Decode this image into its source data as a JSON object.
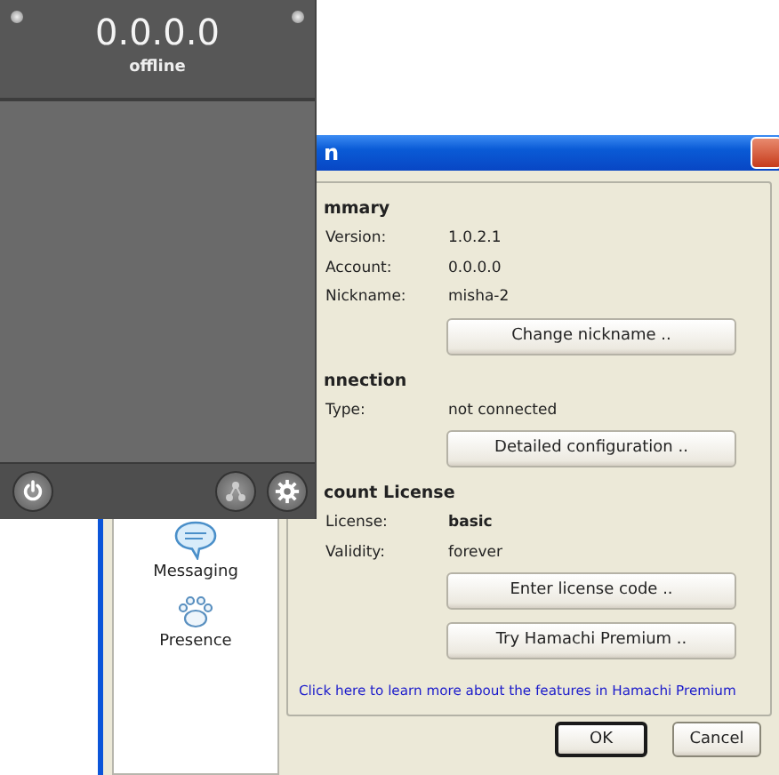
{
  "client": {
    "address": "0.0.0.0",
    "status": "offline"
  },
  "dialog": {
    "title": "n",
    "sidebar": {
      "items": [
        {
          "label": "Messaging",
          "kind": "messaging"
        },
        {
          "label": "Presence",
          "kind": "presence"
        }
      ]
    },
    "sections": [
      {
        "heading": "mmary",
        "rows": [
          {
            "label": "Version:",
            "value": "1.0.2.1",
            "bold": false
          },
          {
            "label": "Account:",
            "value": "0.0.0.0",
            "bold": false
          },
          {
            "label": "Nickname:",
            "value": "misha-2",
            "bold": false
          }
        ],
        "buttons": [
          "Change nickname .."
        ]
      },
      {
        "heading": "nnection",
        "rows": [
          {
            "label": "Type:",
            "value": "not connected",
            "bold": false
          }
        ],
        "buttons": [
          "Detailed configuration .."
        ]
      },
      {
        "heading": "count License",
        "rows": [
          {
            "label": "License:",
            "value": "basic",
            "bold": true
          },
          {
            "label": "Validity:",
            "value": "forever",
            "bold": false
          }
        ],
        "buttons": [
          "Enter license code ..",
          "Try Hamachi Premium .."
        ]
      }
    ],
    "link": "Click here to learn more about the features in Hamachi Premium",
    "buttons": [
      {
        "label": "OK",
        "default": true
      },
      {
        "label": "Cancel",
        "default": false
      }
    ]
  }
}
